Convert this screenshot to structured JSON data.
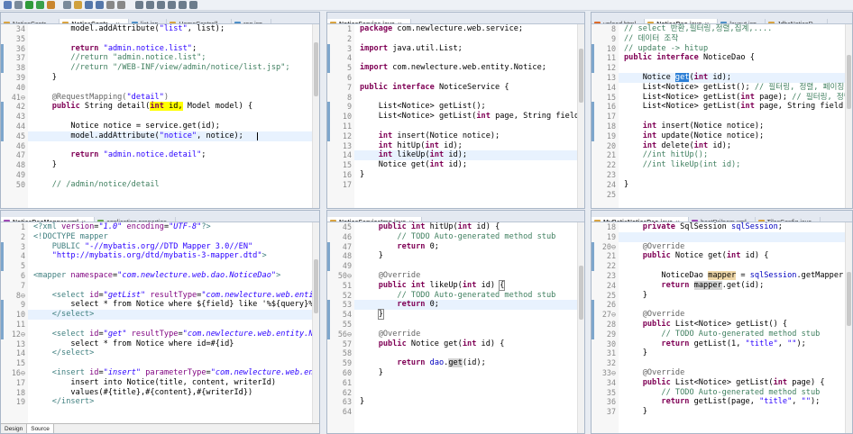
{
  "toolbar": {
    "icons": [
      "save-icon",
      "print-icon",
      "debug-icon",
      "run-icon",
      "server-icon",
      "new-icon",
      "open-icon",
      "search-icon",
      "search-icon",
      "back-icon",
      "forward-icon",
      "nav-icon",
      "nav-icon",
      "nav-icon",
      "nav-icon",
      "nav-icon",
      "nav-icon"
    ]
  },
  "panes": [
    {
      "id": "pane-notice-controller",
      "tabs": [
        {
          "label": "NoticeContr...",
          "type": "java",
          "active": false
        },
        {
          "label": "NoticeContr...",
          "type": "java",
          "active": true
        },
        {
          "label": "list.jsp",
          "type": "jsp",
          "active": false
        },
        {
          "label": "HomeControll...",
          "type": "java",
          "active": false
        },
        {
          "label": "reg.jsp",
          "type": "jsp",
          "active": false
        }
      ],
      "highlight_line": 45,
      "lines": [
        {
          "n": "34",
          "html": "        model.addAttribute(<span class=\"st\">\"list\"</span>, list);"
        },
        {
          "n": "35",
          "html": ""
        },
        {
          "n": "36",
          "html": "        <span class=\"kw\">return</span> <span class=\"st\">\"admin.notice.list\"</span>;"
        },
        {
          "n": "37",
          "html": "        <span class=\"cm\">//return \"admin.notice.list\";</span>"
        },
        {
          "n": "38",
          "html": "        <span class=\"cm\">//return \"/WEB-INF/view/admin/notice/list.jsp\";</span>"
        },
        {
          "n": "39",
          "html": "    }"
        },
        {
          "n": "40",
          "html": ""
        },
        {
          "n": "41⊖",
          "html": "    <span class=\"an\">@RequestMapping(</span><span class=\"st\">\"detail\"</span><span class=\"an\">)</span>"
        },
        {
          "n": "42",
          "html": "    <span class=\"kw\">public</span> String detail(<span style=\"background:#ffff00\"><span class=\"kw\">int</span> id,</span> Model model) {"
        },
        {
          "n": "43",
          "html": ""
        },
        {
          "n": "44",
          "html": "        Notice notice = service.get(id);"
        },
        {
          "n": "45",
          "html": "        model.addAttribute(<span class=\"st\">\"notice\"</span>, notice);"
        },
        {
          "n": "46",
          "html": ""
        },
        {
          "n": "47",
          "html": "        <span class=\"kw\">return</span> <span class=\"st\">\"admin.notice.detail\"</span>;"
        },
        {
          "n": "48",
          "html": "    }"
        },
        {
          "n": "49",
          "html": ""
        },
        {
          "n": "50",
          "html": "    <span class=\"cm\">// /admin/notice/detail</span>"
        }
      ]
    },
    {
      "id": "pane-notice-service",
      "tabs": [
        {
          "label": "NoticeService.java",
          "type": "java",
          "active": true
        }
      ],
      "highlight_line": 14,
      "lines": [
        {
          "n": "1",
          "html": "<span class=\"kw\">package</span> com.newlecture.web.service;"
        },
        {
          "n": "2",
          "html": ""
        },
        {
          "n": "3",
          "html": "<span class=\"kw\">import</span> java.util.List;"
        },
        {
          "n": "4",
          "html": ""
        },
        {
          "n": "5",
          "html": "<span class=\"kw\">import</span> com.newlecture.web.entity.Notice;"
        },
        {
          "n": "6",
          "html": ""
        },
        {
          "n": "7",
          "html": "<span class=\"kw\">public interface</span> NoticeService {"
        },
        {
          "n": "8",
          "html": ""
        },
        {
          "n": "9",
          "html": "    List&lt;Notice&gt; getList();"
        },
        {
          "n": "10",
          "html": "    List&lt;Notice&gt; getList(<span class=\"kw\">int</span> page, String field, Str"
        },
        {
          "n": "11",
          "html": ""
        },
        {
          "n": "12",
          "html": "    <span class=\"kw\">int</span> insert(Notice notice);"
        },
        {
          "n": "13",
          "html": "    <span class=\"kw\">int</span> hitUp(<span class=\"kw\">int</span> id);"
        },
        {
          "n": "14",
          "html": "    <span class=\"kw\">int</span> likeUp(<span class=\"kw\">int</span> id);"
        },
        {
          "n": "15",
          "html": "    Notice get(<span class=\"kw\">int</span> id);"
        },
        {
          "n": "16",
          "html": "}"
        },
        {
          "n": "17",
          "html": ""
        }
      ]
    },
    {
      "id": "pane-notice-dao",
      "tabs": [
        {
          "label": "upload.html",
          "type": "html",
          "active": false
        },
        {
          "label": "NoticeDao.java",
          "type": "java",
          "active": true
        },
        {
          "label": "layout.jsp",
          "type": "jsp",
          "active": false
        },
        {
          "label": "JdbcNoticeD...",
          "type": "java",
          "active": false
        }
      ],
      "highlight_line": 13,
      "lines": [
        {
          "n": "8",
          "html": "<span class=\"cm\">// select 반환,필터링,정렬,집계,....</span>"
        },
        {
          "n": "9",
          "html": "<span class=\"cm\">// 데이터 조작</span>"
        },
        {
          "n": "10",
          "html": "<span class=\"cm\">// update -&gt; hitup</span>"
        },
        {
          "n": "11",
          "html": "<span class=\"kw\">public interface</span> NoticeDao {"
        },
        {
          "n": "12",
          "html": ""
        },
        {
          "n": "13",
          "html": "    Notice <span style=\"background:#2c7fd6;color:#fff\">get</span>(<span class=\"kw\">int</span> id);"
        },
        {
          "n": "14",
          "html": "    List&lt;Notice&gt; getList(); <span class=\"cm\">// 필터링, 정렬, 페이징, 조</span>"
        },
        {
          "n": "15",
          "html": "    List&lt;Notice&gt; getList(<span class=\"kw\">int</span> page); <span class=\"cm\">// 필터링, 정렬,</span>"
        },
        {
          "n": "16",
          "html": "    List&lt;Notice&gt; getList(<span class=\"kw\">int</span> page, String field, S"
        },
        {
          "n": "17",
          "html": ""
        },
        {
          "n": "18",
          "html": "    <span class=\"kw\">int</span> insert(Notice notice);"
        },
        {
          "n": "19",
          "html": "    <span class=\"kw\">int</span> update(Notice notice);"
        },
        {
          "n": "20",
          "html": "    <span class=\"kw\">int</span> delete(<span class=\"kw\">int</span> id);"
        },
        {
          "n": "21",
          "html": "    <span class=\"cm\">//int hitUp();</span>"
        },
        {
          "n": "22",
          "html": "    <span class=\"cm\">//int likeUp(int id);</span>"
        },
        {
          "n": "23",
          "html": ""
        },
        {
          "n": "24",
          "html": "}"
        },
        {
          "n": "25",
          "html": ""
        }
      ]
    },
    {
      "id": "pane-notice-mapper",
      "tabs": [
        {
          "label": "NoticeDaoMapper.xml",
          "type": "xml",
          "active": true
        },
        {
          "label": "application.properties",
          "type": "prop",
          "active": false
        }
      ],
      "highlight_line": 10,
      "bottom_tabs": [
        "Design",
        "Source"
      ],
      "lines": [
        {
          "n": "1",
          "html": "<span class=\"tg\">&lt;?xml</span> <span class=\"at\">version</span>=<span class=\"av\">\"1.0\"</span> <span class=\"at\">encoding</span>=<span class=\"av\">\"UTF-8\"</span><span class=\"tg\">?&gt;</span>"
        },
        {
          "n": "2",
          "html": "<span class=\"tg\">&lt;!DOCTYPE mapper</span>"
        },
        {
          "n": "3",
          "html": "    <span class=\"tg\">PUBLIC</span> <span class=\"st\">\"-//mybatis.org//DTD Mapper 3.0//EN\"</span>"
        },
        {
          "n": "4",
          "html": "    <span class=\"st\">\"http://mybatis.org/dtd/mybatis-3-mapper.dtd\"</span><span class=\"tg\">&gt;</span>"
        },
        {
          "n": "5",
          "html": ""
        },
        {
          "n": "6",
          "html": "<span class=\"tg\">&lt;mapper</span> <span class=\"at\">namespace</span>=<span class=\"av\">\"com.newlecture.web.dao.NoticeDao\"</span><span class=\"tg\">&gt;</span>"
        },
        {
          "n": "7",
          "html": ""
        },
        {
          "n": "8⊖",
          "html": "    <span class=\"tg\">&lt;select</span> <span class=\"at\">id</span>=<span class=\"av\">\"getList\"</span> <span class=\"at\">resultType</span>=<span class=\"av\">\"com.newlecture.web.entity</span>"
        },
        {
          "n": "9",
          "html": "        select * from Notice where ${field} like '%${query}%'"
        },
        {
          "n": "10",
          "html": "    <span class=\"tg\">&lt;/select&gt;</span>"
        },
        {
          "n": "11",
          "html": ""
        },
        {
          "n": "12⊖",
          "html": "    <span class=\"tg\">&lt;select</span> <span class=\"at\">id</span>=<span class=\"av\">\"get\"</span> <span class=\"at\">resultType</span>=<span class=\"av\">\"com.newlecture.web.entity.Not</span>"
        },
        {
          "n": "13",
          "html": "        select * from Notice where id=#{id}"
        },
        {
          "n": "14",
          "html": "    <span class=\"tg\">&lt;/select&gt;</span>"
        },
        {
          "n": "15",
          "html": ""
        },
        {
          "n": "16⊖",
          "html": "    <span class=\"tg\">&lt;insert</span> <span class=\"at\">id</span>=<span class=\"av\">\"insert\"</span> <span class=\"at\">parameterType</span>=<span class=\"av\">\"com.newlecture.web.enti</span>"
        },
        {
          "n": "17",
          "html": "        insert into Notice(title, content, writerId)"
        },
        {
          "n": "18",
          "html": "        values(#{title},#{content},#{writerId})"
        },
        {
          "n": "19",
          "html": "    <span class=\"tg\">&lt;/insert&gt;</span>"
        }
      ]
    },
    {
      "id": "pane-notice-service-imp",
      "tabs": [
        {
          "label": "NoticeServiceImp.java",
          "type": "java",
          "active": true
        }
      ],
      "highlight_line": 53,
      "lines": [
        {
          "n": "45",
          "html": "    <span class=\"kw\">public int</span> hitUp(<span class=\"kw\">int</span> id) {"
        },
        {
          "n": "46",
          "html": "        <span class=\"cm\">// TODO Auto-generated method stub</span>"
        },
        {
          "n": "47",
          "html": "        <span class=\"kw\">return</span> 0;"
        },
        {
          "n": "48",
          "html": "    }"
        },
        {
          "n": "49",
          "html": ""
        },
        {
          "n": "50⊖",
          "html": "    <span class=\"an\">@Override</span>"
        },
        {
          "n": "51",
          "html": "    <span class=\"kw\">public int</span> likeUp(<span class=\"kw\">int</span> id) <span style=\"outline:1px solid #888\">{</span>"
        },
        {
          "n": "52",
          "html": "        <span class=\"cm\">// TODO Auto-generated method stub</span>"
        },
        {
          "n": "53",
          "html": "        <span class=\"kw\">return</span> 0;"
        },
        {
          "n": "54",
          "html": "    <span style=\"outline:1px solid #888\">}</span>"
        },
        {
          "n": "55",
          "html": ""
        },
        {
          "n": "56⊖",
          "html": "    <span class=\"an\">@Override</span>"
        },
        {
          "n": "57",
          "html": "    <span class=\"kw\">public</span> Notice get(<span class=\"kw\">int</span> id) {"
        },
        {
          "n": "58",
          "html": ""
        },
        {
          "n": "59",
          "html": "        <span class=\"kw\">return</span> <span class=\"fd\">dao</span>.<span style=\"background:#d4d4d4\">get</span>(id);"
        },
        {
          "n": "60",
          "html": "    }"
        },
        {
          "n": "61",
          "html": ""
        },
        {
          "n": "62",
          "html": ""
        },
        {
          "n": "63",
          "html": "}"
        },
        {
          "n": "64",
          "html": ""
        }
      ]
    },
    {
      "id": "pane-mybatis-notice-dao",
      "tabs": [
        {
          "label": "MyBatisNoticeDao.java",
          "type": "java",
          "active": true
        },
        {
          "label": "bootPrj/pom.xml",
          "type": "xml",
          "active": false
        },
        {
          "label": "TilesConfig.java",
          "type": "java",
          "active": false
        }
      ],
      "highlight_line": 19,
      "lines": [
        {
          "n": "18",
          "html": "    <span class=\"kw\">private</span> SqlSession <span class=\"fd\">sqlSession</span>;"
        },
        {
          "n": "19",
          "html": ""
        },
        {
          "n": "20⊖",
          "html": "    <span class=\"an\">@Override</span>"
        },
        {
          "n": "21",
          "html": "    <span class=\"kw\">public</span> Notice get(<span class=\"kw\">int</span> id) {"
        },
        {
          "n": "22",
          "html": ""
        },
        {
          "n": "23",
          "html": "        NoticeDao <span style=\"background:#f0d8a8\">mapper</span> = <span class=\"fd\">sqlSession</span>.getMapper(Noti"
        },
        {
          "n": "24",
          "html": "        <span class=\"kw\">return</span> <span style=\"background:#d4d4d4\">mapper</span>.get(id);"
        },
        {
          "n": "25",
          "html": "    }"
        },
        {
          "n": "26",
          "html": ""
        },
        {
          "n": "27⊖",
          "html": "    <span class=\"an\">@Override</span>"
        },
        {
          "n": "28",
          "html": "    <span class=\"kw\">public</span> List&lt;Notice&gt; getList() {"
        },
        {
          "n": "29",
          "html": "        <span class=\"cm\">// TODO Auto-generated method stub</span>"
        },
        {
          "n": "30",
          "html": "        <span class=\"kw\">return</span> getList(1, <span class=\"st\">\"title\"</span>, <span class=\"st\">\"\"</span>);"
        },
        {
          "n": "31",
          "html": "    }"
        },
        {
          "n": "32",
          "html": ""
        },
        {
          "n": "33⊖",
          "html": "    <span class=\"an\">@Override</span>"
        },
        {
          "n": "34",
          "html": "    <span class=\"kw\">public</span> List&lt;Notice&gt; getList(<span class=\"kw\">int</span> page) {"
        },
        {
          "n": "35",
          "html": "        <span class=\"cm\">// TODO Auto-generated method stub</span>"
        },
        {
          "n": "36",
          "html": "        <span class=\"kw\">return</span> getList(page, <span class=\"st\">\"title\"</span>, <span class=\"st\">\"\"</span>);"
        },
        {
          "n": "37",
          "html": "    }"
        }
      ]
    }
  ]
}
